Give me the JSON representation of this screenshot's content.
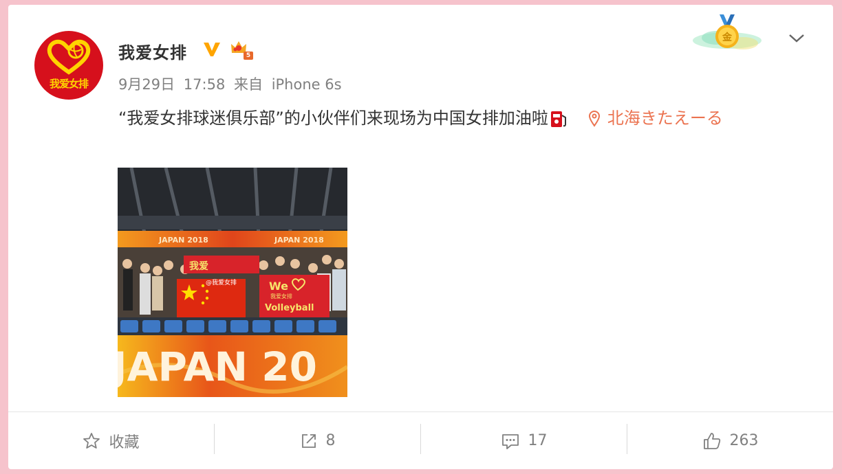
{
  "user": {
    "name": "我爱女排",
    "avatar_text": "我爱女排",
    "verified_badge": "V",
    "vip_level": "5"
  },
  "post": {
    "date": "9月29日",
    "time": "17:58",
    "source_prefix": "来自",
    "source": "iPhone 6s",
    "text": "“我爱女排球迷俱乐部”的小伙伴们来现场为中国女排加油啦",
    "emoji_icon": "fuel-pump-icon",
    "location": "北海きたえーる"
  },
  "photo": {
    "banner_top": "JAPAN 2018",
    "banner_bottom": "JAPAN 20",
    "flag_text_1": "We",
    "flag_text_2": "我爱女排",
    "flag_text_3": "Volleyball",
    "watermark": "@我爱女排"
  },
  "actions": {
    "favorite_label": "收藏",
    "repost_count": "8",
    "comment_count": "17",
    "like_count": "263"
  },
  "colors": {
    "page_bg": "#f6c3cc",
    "accent": "#eb7350",
    "verified": "#ffa500",
    "avatar_red": "#d6101c"
  }
}
